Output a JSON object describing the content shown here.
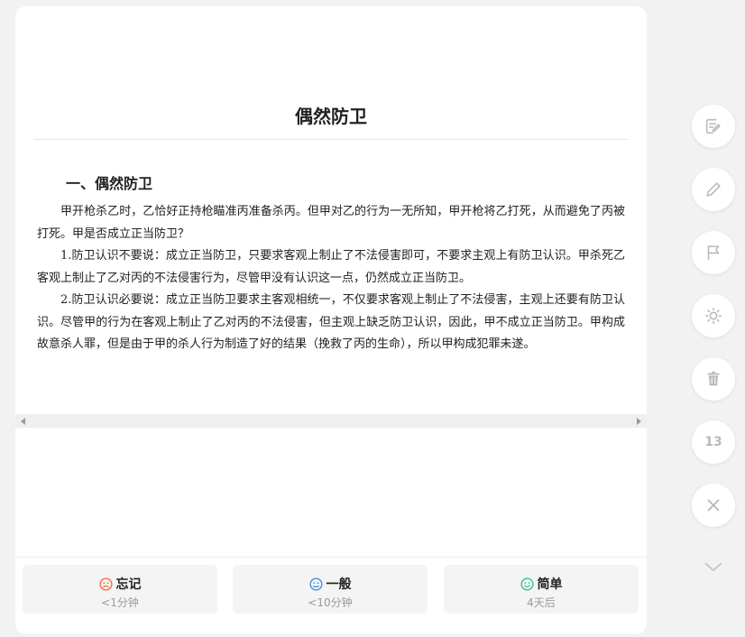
{
  "card": {
    "title": "偶然防卫",
    "section_heading": "一、偶然防卫",
    "paragraphs": [
      "甲开枪杀乙时，乙恰好正持枪瞄准丙准备杀丙。但甲对乙的行为一无所知，甲开枪将乙打死，从而避免了丙被打死。甲是否成立正当防卫？",
      "1.防卫认识不要说：成立正当防卫，只要求客观上制止了不法侵害即可，不要求主观上有防卫认识。甲杀死乙客观上制止了乙对丙的不法侵害行为，尽管甲没有认识这一点，仍然成立正当防卫。",
      "2.防卫认识必要说：成立正当防卫要求主客观相统一，不仅要求客观上制止了不法侵害，主观上还要有防卫认识。尽管甲的行为在客观上制止了乙对丙的不法侵害，但主观上缺乏防卫认识，因此，甲不成立正当防卫。甲构成故意杀人罪，但是由于甲的杀人行为制造了好的结果（挽救了丙的生命），所以甲构成犯罪未遂。"
    ]
  },
  "ratings": [
    {
      "label": "忘记",
      "sub": "<1分钟",
      "icon": "sad-face-icon",
      "color": "#f26b3a"
    },
    {
      "label": "一般",
      "sub": "<10分钟",
      "icon": "neutral-face-icon",
      "color": "#3b8de0"
    },
    {
      "label": "简单",
      "sub": "4天后",
      "icon": "happy-face-icon",
      "color": "#2fb99a"
    }
  ],
  "sidebar": {
    "buttons": [
      "edit-note-icon",
      "pencil-icon",
      "flag-icon",
      "brightness-icon",
      "trash-icon",
      "count",
      "close-icon"
    ],
    "count": "13",
    "icon_color": "#b9b9b9"
  }
}
